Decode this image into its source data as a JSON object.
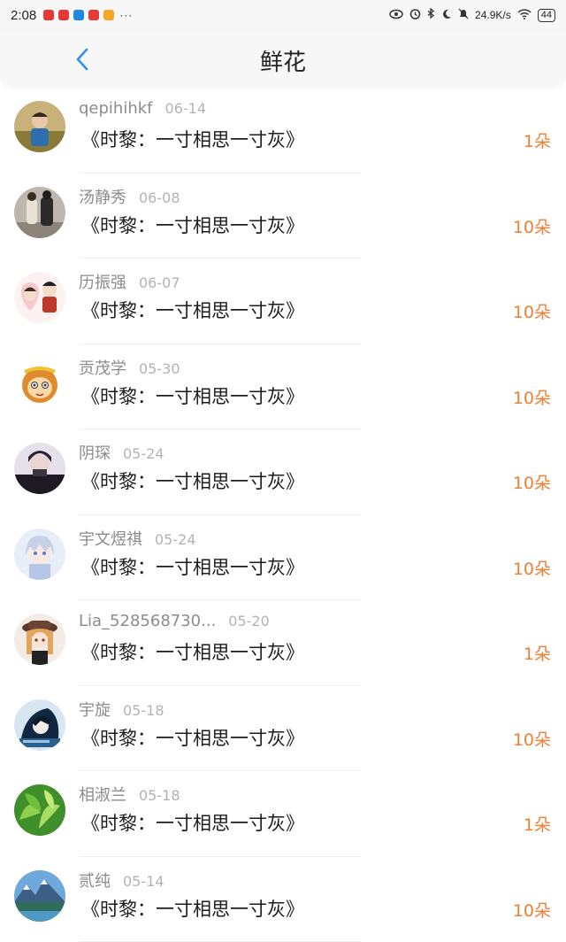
{
  "status_bar": {
    "time": "2:08",
    "dots": "···",
    "net_speed": "24.9K/s",
    "battery": "44",
    "app_colors": [
      "#e53935",
      "#e53935",
      "#1e88e5",
      "#e53935",
      "#f5a623"
    ]
  },
  "header": {
    "title": "鲜花",
    "back_icon": "chevron-left-icon",
    "accent": "#2e8ff0"
  },
  "colors": {
    "count": "#ef7f33",
    "name": "#8c8c8c",
    "date": "#b3b3b3"
  },
  "items": [
    {
      "name": "qepihihkf",
      "date": "06-14",
      "book": "《时黎：一寸相思一寸灰》",
      "count": "1朵",
      "avatar": "boy-in-field"
    },
    {
      "name": "汤静秀",
      "date": "06-08",
      "book": "《时黎：一寸相思一寸灰》",
      "count": "10朵",
      "avatar": "two-people-walking"
    },
    {
      "name": "历振强",
      "date": "06-07",
      "book": "《时黎：一寸相思一寸灰》",
      "count": "10朵",
      "avatar": "cartoon-couple"
    },
    {
      "name": "贡茂学",
      "date": "05-30",
      "book": "《时黎：一寸相思一寸灰》",
      "count": "10朵",
      "avatar": "monkey-king"
    },
    {
      "name": "阴琛",
      "date": "05-24",
      "book": "《时黎：一寸相思一寸灰》",
      "count": "10朵",
      "avatar": "dark-portrait"
    },
    {
      "name": "宇文煜祺",
      "date": "05-24",
      "book": "《时黎：一寸相思一寸灰》",
      "count": "10朵",
      "avatar": "anime-silver-hair"
    },
    {
      "name": "Lia_528568730...",
      "date": "05-20",
      "book": "《时黎：一寸相思一寸灰》",
      "count": "1朵",
      "avatar": "anime-girl-hat"
    },
    {
      "name": "宇旋",
      "date": "05-18",
      "book": "《时黎：一寸相思一寸灰》",
      "count": "10朵",
      "avatar": "anime-dark-blue"
    },
    {
      "name": "相淑兰",
      "date": "05-18",
      "book": "《时黎：一寸相思一寸灰》",
      "count": "1朵",
      "avatar": "green-leaves"
    },
    {
      "name": "贰纯",
      "date": "05-14",
      "book": "《时黎：一寸相思一寸灰》",
      "count": "10朵",
      "avatar": "mountain-lake"
    }
  ]
}
